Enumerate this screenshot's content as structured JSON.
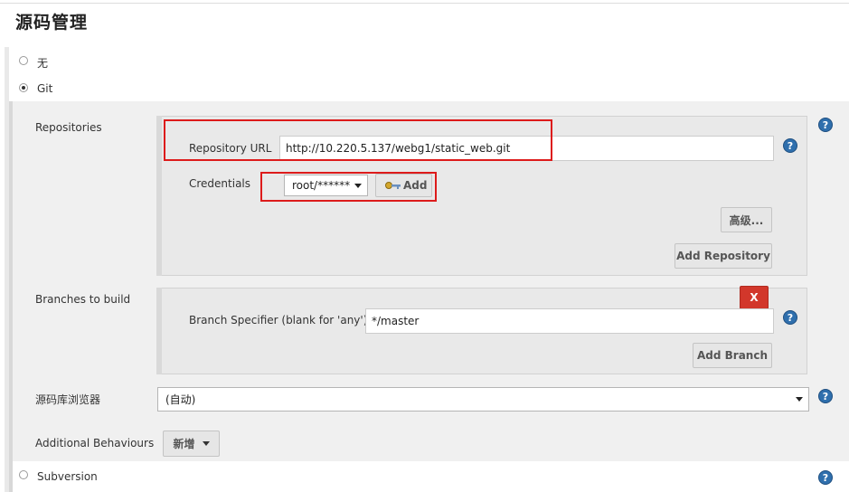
{
  "section": {
    "title": "源码管理"
  },
  "scm_options": {
    "none_label": "无",
    "git_label": "Git",
    "subversion_label": "Subversion"
  },
  "repositories": {
    "label": "Repositories",
    "url_label": "Repository URL",
    "url_value": "http://10.220.5.137/webg1/static_web.git",
    "credentials_label": "Credentials",
    "credentials_value": "root/******",
    "add_label": "Add",
    "advanced_label": "高级...",
    "add_repository_label": "Add Repository"
  },
  "branches": {
    "label": "Branches to build",
    "specifier_label": "Branch Specifier (blank for 'any')",
    "specifier_value": "*/master",
    "delete_label": "X",
    "add_branch_label": "Add Branch"
  },
  "browser": {
    "label": "源码库浏览器",
    "value": "(自动)"
  },
  "behaviours": {
    "label": "Additional Behaviours",
    "add_label": "新增"
  },
  "help_symbol": "?",
  "colors": {
    "highlight_red": "#dd1b1b",
    "help_blue": "#2f6fad",
    "delete_red": "#d2372b"
  },
  "icons": {
    "help": "help-circle-icon",
    "key": "key-icon",
    "dropdown": "chevron-down-icon"
  }
}
